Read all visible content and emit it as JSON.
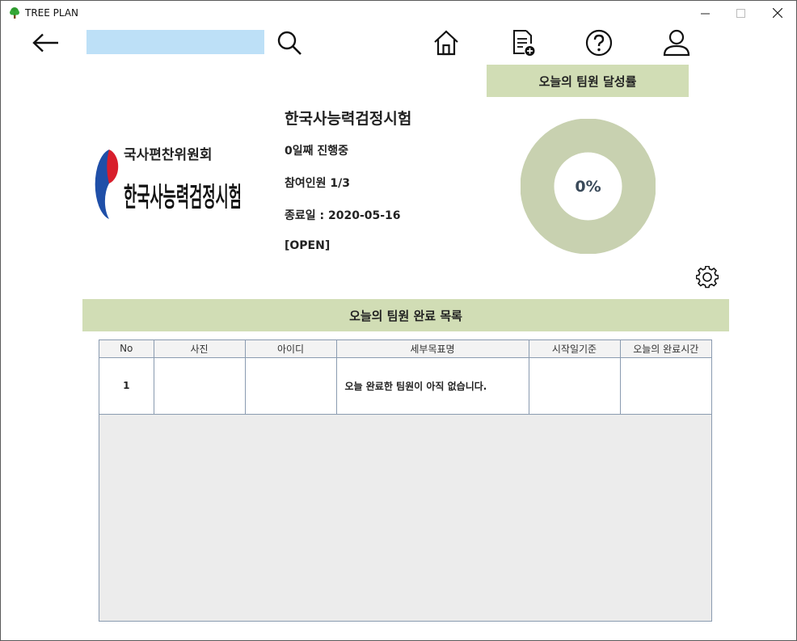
{
  "window": {
    "title": "TREE PLAN"
  },
  "search": {
    "value": "",
    "placeholder": ""
  },
  "rate": {
    "header": "오늘의 팀원 달성률",
    "value_text": "0%",
    "percent": 0
  },
  "study": {
    "logo_text_top": "국사편찬위원회",
    "logo_text_main": "한국사능력검정시험",
    "title": "한국사능력검정시험",
    "days": "0일째 진행중",
    "members": "참여인원 1/3",
    "end_date": "종료일 : 2020-05-16",
    "status": "[OPEN]"
  },
  "list": {
    "header": "오늘의 팀원 완료 목록",
    "columns": [
      "No",
      "사진",
      "아이디",
      "세부목표명",
      "시작일기준",
      "오늘의 완료시간"
    ],
    "rows": [
      {
        "no": "1",
        "photo": "",
        "id": "",
        "goal": "오늘 완료한 팀원이 아직 없습니다.",
        "start": "",
        "time": ""
      }
    ]
  },
  "colors": {
    "accent": "#d1ddb5",
    "donut": "#c8d1b0",
    "search_bg": "#bde0f7"
  },
  "icons": [
    "tree-icon",
    "back-arrow-icon",
    "search-icon",
    "home-icon",
    "document-add-icon",
    "help-icon",
    "user-icon",
    "gear-icon"
  ]
}
